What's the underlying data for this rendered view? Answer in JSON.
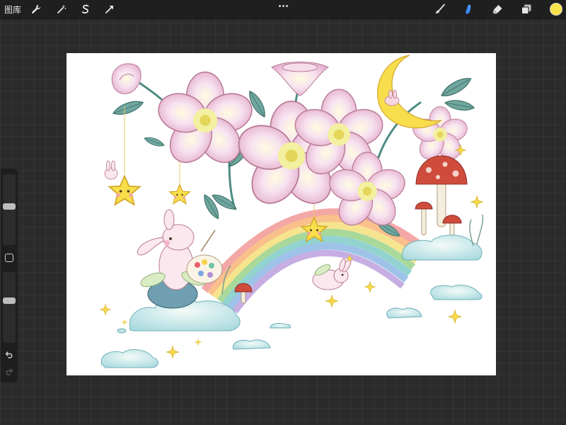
{
  "toolbar": {
    "gallery_label": "图库",
    "left_tools": [
      {
        "name": "actions-wrench-icon"
      },
      {
        "name": "adjustments-wand-icon"
      },
      {
        "name": "selection-s-icon"
      },
      {
        "name": "transform-arrow-icon"
      }
    ],
    "right_tools": [
      {
        "name": "brush-icon",
        "active": false
      },
      {
        "name": "smudge-icon",
        "active": true
      },
      {
        "name": "eraser-icon",
        "active": false
      },
      {
        "name": "layers-icon",
        "active": false
      }
    ],
    "current_color": "#f7e24a",
    "accent_color": "#3d8bff"
  },
  "sidebar": {
    "brush_size_level": 0.55,
    "opacity_level": 0.6,
    "undo_icon": "undo-arrow-icon",
    "redo_icon": "redo-arrow-icon"
  },
  "canvas": {
    "background": "#ffffff",
    "artwork": "illustration"
  }
}
